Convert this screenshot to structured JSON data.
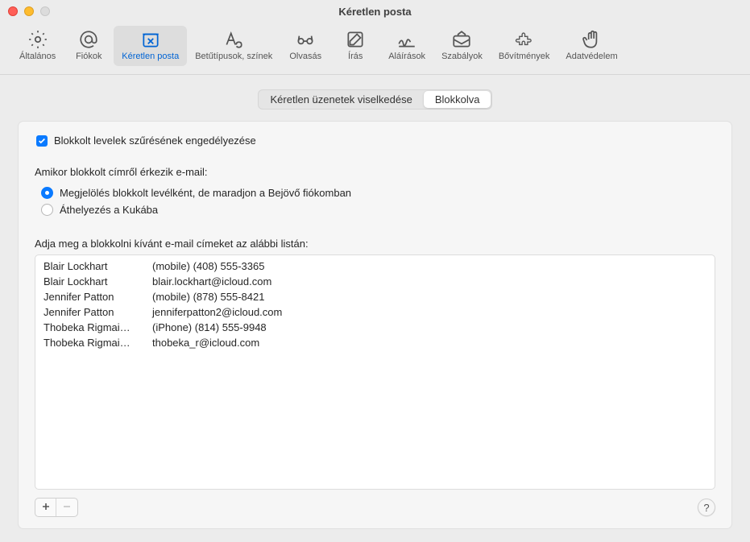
{
  "window": {
    "title": "Kéretlen posta"
  },
  "toolbar": {
    "items": [
      {
        "id": "general",
        "label": "Általános"
      },
      {
        "id": "accounts",
        "label": "Fiókok"
      },
      {
        "id": "junk",
        "label": "Kéretlen posta"
      },
      {
        "id": "fonts",
        "label": "Betűtípusok, színek"
      },
      {
        "id": "reading",
        "label": "Olvasás"
      },
      {
        "id": "writing",
        "label": "Írás"
      },
      {
        "id": "signatures",
        "label": "Aláírások"
      },
      {
        "id": "rules",
        "label": "Szabályok"
      },
      {
        "id": "extensions",
        "label": "Bővítmények"
      },
      {
        "id": "privacy",
        "label": "Adatvédelem"
      }
    ],
    "active_index": 2
  },
  "tabs": {
    "items": [
      "Kéretlen üzenetek viselkedése",
      "Blokkolva"
    ],
    "active_index": 1
  },
  "panel": {
    "enable_checkbox_label": "Blokkolt levelek szűrésének engedélyezése",
    "enable_checkbox_checked": true,
    "incoming_label": "Amikor blokkolt címről érkezik e-mail:",
    "radios": [
      {
        "label": "Megjelölés blokkolt levélként, de maradjon a Bejövő fiókomban",
        "checked": true
      },
      {
        "label": "Áthelyezés a Kukába",
        "checked": false
      }
    ],
    "list_label": "Adja meg a blokkolni kívánt e-mail címeket az alábbi listán:",
    "list": [
      {
        "name": "Blair Lockhart",
        "value": "(mobile) (408) 555-3365"
      },
      {
        "name": "Blair Lockhart",
        "value": "blair.lockhart@icloud.com"
      },
      {
        "name": "Jennifer Patton",
        "value": "(mobile) (878) 555-8421"
      },
      {
        "name": "Jennifer Patton",
        "value": "jenniferpatton2@icloud.com"
      },
      {
        "name": "Thobeka Rigmai…",
        "value": "(iPhone) (814) 555-9948"
      },
      {
        "name": "Thobeka Rigmai…",
        "value": "thobeka_r@icloud.com"
      }
    ],
    "help_label": "?"
  }
}
